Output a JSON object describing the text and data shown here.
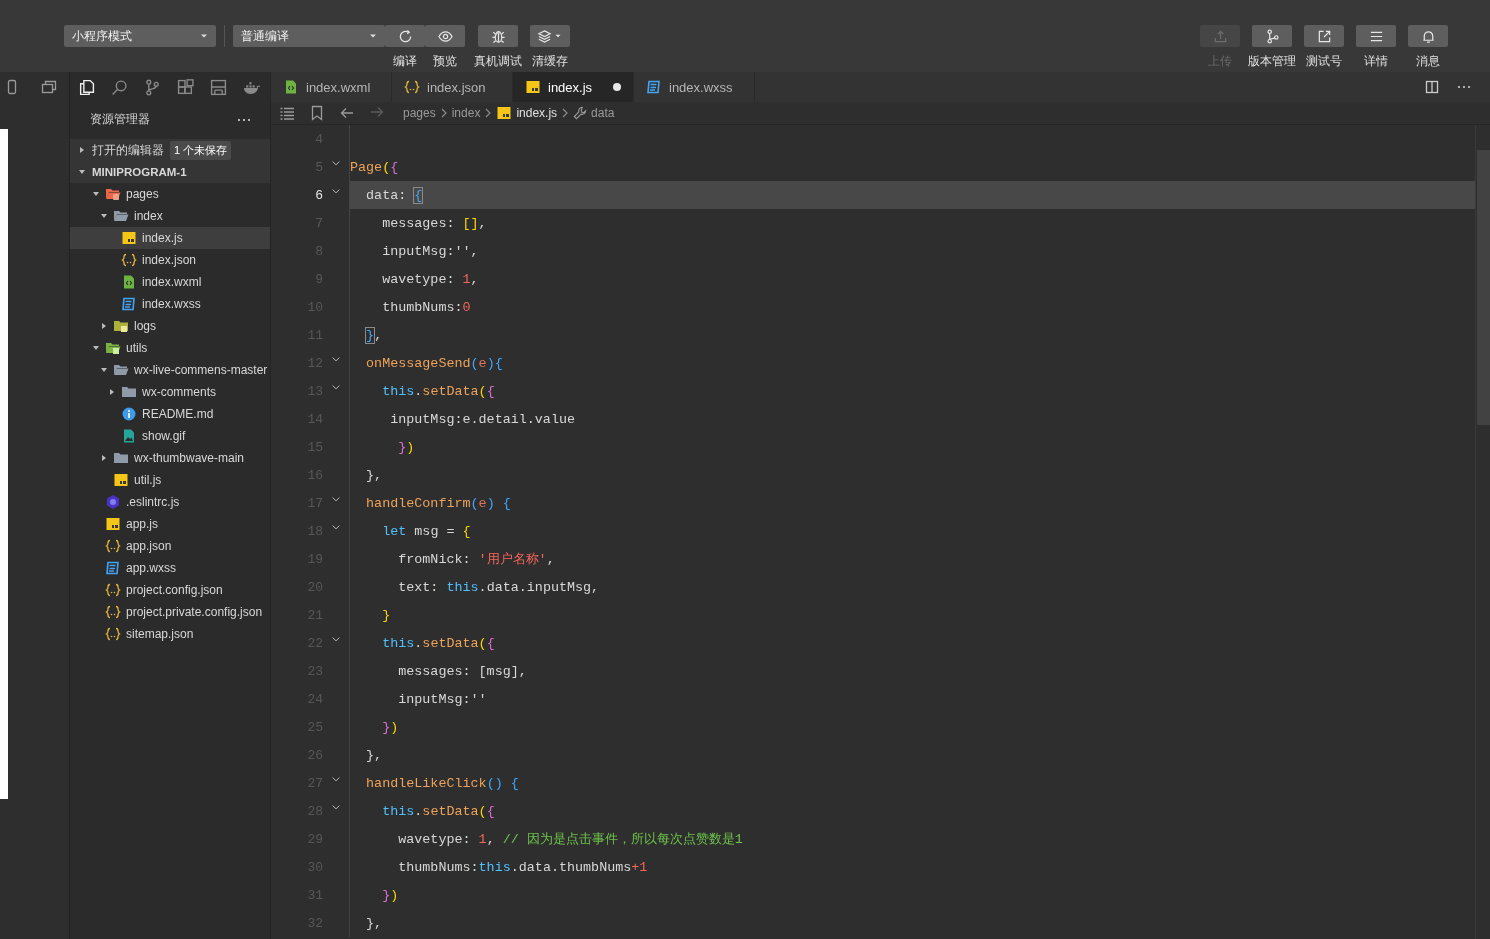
{
  "toolbar": {
    "mode_select": "小程序模式",
    "compile_select": "普通编译",
    "tools": [
      {
        "kind": "compile",
        "label": "编译"
      },
      {
        "kind": "preview",
        "label": "预览"
      },
      {
        "kind": "debug",
        "label": "真机调试"
      },
      {
        "kind": "cache",
        "label": "清缓存"
      }
    ],
    "actions": [
      {
        "kind": "upload",
        "label": "上传",
        "disabled": true
      },
      {
        "kind": "version",
        "label": "版本管理",
        "disabled": false
      },
      {
        "kind": "test",
        "label": "测试号",
        "disabled": false
      },
      {
        "kind": "details",
        "label": "详情",
        "disabled": false
      },
      {
        "kind": "messages",
        "label": "消息",
        "disabled": false
      }
    ]
  },
  "sidebar": {
    "views": [
      {
        "kind": "explorer",
        "selected": true
      },
      {
        "kind": "search",
        "selected": false
      },
      {
        "kind": "git",
        "selected": false
      },
      {
        "kind": "extensions",
        "selected": false
      },
      {
        "kind": "storage",
        "selected": false
      },
      {
        "kind": "docker",
        "selected": false
      }
    ],
    "title": "资源管理器",
    "sections": [
      {
        "label": "打开的编辑器",
        "expanded": false,
        "badge": "1 个未保存"
      },
      {
        "label": "MINIPROGRAM-1",
        "expanded": true,
        "children": [
          {
            "label": "pages",
            "kind": "folder-pages",
            "expanded": true,
            "selected": false,
            "children": [
              {
                "label": "index",
                "kind": "folder",
                "expanded": true,
                "selected": false,
                "children": [
                  {
                    "label": "index.js",
                    "kind": "js",
                    "selected": true
                  },
                  {
                    "label": "index.json",
                    "kind": "json",
                    "selected": false
                  },
                  {
                    "label": "index.wxml",
                    "kind": "wxml",
                    "selected": false
                  },
                  {
                    "label": "index.wxss",
                    "kind": "wxss",
                    "selected": false
                  }
                ]
              },
              {
                "label": "logs",
                "kind": "folder-logs",
                "expanded": false,
                "selected": false
              }
            ]
          },
          {
            "label": "utils",
            "kind": "folder-utils",
            "expanded": true,
            "selected": false,
            "children": [
              {
                "label": "wx-live-commens-master",
                "kind": "folder",
                "expanded": true,
                "selected": false,
                "children": [
                  {
                    "label": "wx-comments",
                    "kind": "folder",
                    "expanded": false,
                    "selected": false
                  },
                  {
                    "label": "README.md",
                    "kind": "info",
                    "selected": false
                  },
                  {
                    "label": "show.gif",
                    "kind": "image",
                    "selected": false
                  }
                ]
              },
              {
                "label": "wx-thumbwave-main",
                "kind": "folder",
                "expanded": false,
                "selected": false
              },
              {
                "label": "util.js",
                "kind": "js",
                "selected": false
              }
            ]
          },
          {
            "label": ".eslintrc.js",
            "kind": "eslint",
            "selected": false
          },
          {
            "label": "app.js",
            "kind": "js",
            "selected": false
          },
          {
            "label": "app.json",
            "kind": "json",
            "selected": false
          },
          {
            "label": "app.wxss",
            "kind": "wxss",
            "selected": false
          },
          {
            "label": "project.config.json",
            "kind": "json",
            "selected": false
          },
          {
            "label": "project.private.config.json",
            "kind": "json",
            "selected": false
          },
          {
            "label": "sitemap.json",
            "kind": "json",
            "selected": false
          }
        ]
      }
    ]
  },
  "tabs": [
    {
      "label": "index.wxml",
      "kind": "wxml",
      "selected": false,
      "modified": false
    },
    {
      "label": "index.json",
      "kind": "json",
      "selected": false,
      "modified": false
    },
    {
      "label": "index.js",
      "kind": "js",
      "selected": true,
      "modified": true
    },
    {
      "label": "index.wxss",
      "kind": "wxss",
      "selected": false,
      "modified": false
    }
  ],
  "breadcrumb": [
    {
      "kind": "folder",
      "label": "pages"
    },
    {
      "kind": "folder",
      "label": "index"
    },
    {
      "kind": "js",
      "label": "index.js"
    },
    {
      "kind": "property",
      "label": "data"
    }
  ],
  "code": [
    {
      "number": "4",
      "fold": false,
      "current": false
    },
    {
      "number": "5",
      "fold": true,
      "current": false,
      "tokens": [
        {
          "kind": "fn",
          "text": "Page"
        },
        {
          "kind": "p1",
          "text": "("
        },
        {
          "kind": "p2",
          "text": "{"
        }
      ]
    },
    {
      "number": "6",
      "fold": true,
      "current": true,
      "tokens": [
        {
          "kind": "text",
          "text": "  data: "
        },
        {
          "kind": "match",
          "text": "{"
        }
      ]
    },
    {
      "number": "7",
      "fold": false,
      "current": false,
      "tokens": [
        {
          "kind": "text",
          "text": "    messages: "
        },
        {
          "kind": "p1",
          "text": "[]"
        },
        {
          "kind": "text",
          "text": ","
        }
      ]
    },
    {
      "number": "8",
      "fold": false,
      "current": false,
      "tokens": [
        {
          "kind": "text",
          "text": "    inputMsg:'',"
        }
      ]
    },
    {
      "number": "9",
      "fold": false,
      "current": false,
      "tokens": [
        {
          "kind": "text",
          "text": "    wavetype: "
        },
        {
          "kind": "num",
          "text": "1"
        },
        {
          "kind": "text",
          "text": ","
        }
      ]
    },
    {
      "number": "10",
      "fold": false,
      "current": false,
      "tokens": [
        {
          "kind": "text",
          "text": "    thumbNums:"
        },
        {
          "kind": "num",
          "text": "0"
        }
      ]
    },
    {
      "number": "11",
      "fold": false,
      "current": false,
      "tokens": [
        {
          "kind": "match",
          "text": "  }"
        },
        {
          "kind": "text",
          "text": ","
        }
      ]
    },
    {
      "number": "12",
      "fold": true,
      "current": false,
      "tokens": [
        {
          "kind": "fn",
          "text": "  onMessageSend"
        },
        {
          "kind": "p3",
          "text": "("
        },
        {
          "kind": "param",
          "text": "e"
        },
        {
          "kind": "p3",
          "text": "){"
        }
      ]
    },
    {
      "number": "13",
      "fold": true,
      "current": false,
      "tokens": [
        {
          "kind": "kw",
          "text": "    this"
        },
        {
          "kind": "text",
          "text": "."
        },
        {
          "kind": "fn",
          "text": "setData"
        },
        {
          "kind": "p1",
          "text": "("
        },
        {
          "kind": "p2",
          "text": "{"
        }
      ]
    },
    {
      "number": "14",
      "fold": false,
      "current": false,
      "tokens": [
        {
          "kind": "text",
          "text": "     inputMsg:e.detail.value"
        }
      ]
    },
    {
      "number": "15",
      "fold": false,
      "current": false,
      "tokens": [
        {
          "kind": "p2",
          "text": "      }"
        },
        {
          "kind": "p1",
          "text": ")"
        }
      ]
    },
    {
      "number": "16",
      "fold": false,
      "current": false,
      "tokens": [
        {
          "kind": "text",
          "text": "  },"
        }
      ]
    },
    {
      "number": "17",
      "fold": true,
      "current": false,
      "tokens": [
        {
          "kind": "fn",
          "text": "  handleConfirm"
        },
        {
          "kind": "p3",
          "text": "("
        },
        {
          "kind": "param",
          "text": "e"
        },
        {
          "kind": "p3",
          "text": ")"
        },
        {
          "kind": "p3",
          "text": " {"
        }
      ]
    },
    {
      "number": "18",
      "fold": true,
      "current": false,
      "tokens": [
        {
          "kind": "kw",
          "text": "    let"
        },
        {
          "kind": "text",
          "text": " msg = "
        },
        {
          "kind": "p1",
          "text": "{"
        }
      ]
    },
    {
      "number": "19",
      "fold": false,
      "current": false,
      "tokens": [
        {
          "kind": "text",
          "text": "      fromNick: "
        },
        {
          "kind": "str",
          "text": "'用户名称'"
        },
        {
          "kind": "text",
          "text": ","
        }
      ]
    },
    {
      "number": "20",
      "fold": false,
      "current": false,
      "tokens": [
        {
          "kind": "text",
          "text": "      text: "
        },
        {
          "kind": "kw",
          "text": "this"
        },
        {
          "kind": "text",
          "text": ".data.inputMsg,"
        }
      ]
    },
    {
      "number": "21",
      "fold": false,
      "current": false,
      "tokens": [
        {
          "kind": "p1",
          "text": "    }"
        }
      ]
    },
    {
      "number": "22",
      "fold": true,
      "current": false,
      "tokens": [
        {
          "kind": "kw",
          "text": "    this"
        },
        {
          "kind": "text",
          "text": "."
        },
        {
          "kind": "fn",
          "text": "setData"
        },
        {
          "kind": "p1",
          "text": "("
        },
        {
          "kind": "p2",
          "text": "{"
        }
      ]
    },
    {
      "number": "23",
      "fold": false,
      "current": false,
      "tokens": [
        {
          "kind": "text",
          "text": "      messages: [msg],"
        }
      ]
    },
    {
      "number": "24",
      "fold": false,
      "current": false,
      "tokens": [
        {
          "kind": "text",
          "text": "      inputMsg:''"
        }
      ]
    },
    {
      "number": "25",
      "fold": false,
      "current": false,
      "tokens": [
        {
          "kind": "p2",
          "text": "    }"
        },
        {
          "kind": "p1",
          "text": ")"
        }
      ]
    },
    {
      "number": "26",
      "fold": false,
      "current": false,
      "tokens": [
        {
          "kind": "text",
          "text": "  },"
        }
      ]
    },
    {
      "number": "27",
      "fold": true,
      "current": false,
      "tokens": [
        {
          "kind": "fn",
          "text": "  handleLikeClick"
        },
        {
          "kind": "p3",
          "text": "()"
        },
        {
          "kind": "p3",
          "text": " {"
        }
      ]
    },
    {
      "number": "28",
      "fold": true,
      "current": false,
      "tokens": [
        {
          "kind": "kw",
          "text": "    this"
        },
        {
          "kind": "text",
          "text": "."
        },
        {
          "kind": "fn",
          "text": "setData"
        },
        {
          "kind": "p1",
          "text": "("
        },
        {
          "kind": "p2",
          "text": "{"
        }
      ]
    },
    {
      "number": "29",
      "fold": false,
      "current": false,
      "tokens": [
        {
          "kind": "text",
          "text": "      wavetype: "
        },
        {
          "kind": "num",
          "text": "1"
        },
        {
          "kind": "text",
          "text": ", "
        },
        {
          "kind": "comment",
          "text": "// 因为是点击事件，所以每次点赞数是1"
        }
      ]
    },
    {
      "number": "30",
      "fold": false,
      "current": false,
      "tokens": [
        {
          "kind": "text",
          "text": "      thumbNums:"
        },
        {
          "kind": "kw",
          "text": "this"
        },
        {
          "kind": "text",
          "text": ".data.thumbNums"
        },
        {
          "kind": "num",
          "text": "+1"
        }
      ]
    },
    {
      "number": "31",
      "fold": false,
      "current": false,
      "tokens": [
        {
          "kind": "p2",
          "text": "    }"
        },
        {
          "kind": "p1",
          "text": ")"
        }
      ]
    },
    {
      "number": "32",
      "fold": false,
      "current": false,
      "tokens": [
        {
          "kind": "text",
          "text": "  },"
        }
      ]
    }
  ]
}
